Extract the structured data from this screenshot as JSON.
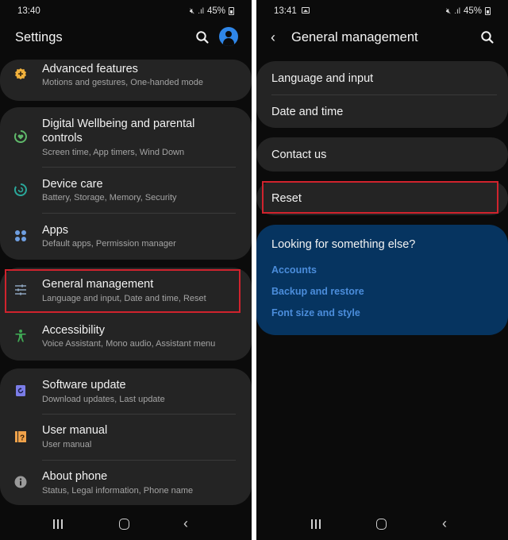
{
  "left_screen": {
    "status": {
      "time": "13:40",
      "battery": "45%"
    },
    "header": {
      "title": "Settings",
      "search_icon": "search-icon",
      "avatar_icon": "account-icon"
    },
    "items": [
      {
        "title": "Advanced features",
        "subtitle": "Motions and gestures, One-handed mode",
        "icon": "advanced-features-icon",
        "icon_color": "#f1b13c"
      },
      {
        "title": "Digital Wellbeing and parental controls",
        "subtitle": "Screen time, App timers, Wind Down",
        "icon": "digital-wellbeing-icon",
        "icon_color": "#5fb86a"
      },
      {
        "title": "Device care",
        "subtitle": "Battery, Storage, Memory, Security",
        "icon": "device-care-icon",
        "icon_color": "#2aa79a"
      },
      {
        "title": "Apps",
        "subtitle": "Default apps, Permission manager",
        "icon": "apps-icon",
        "icon_color": "#6e9ee0"
      },
      {
        "title": "General management",
        "subtitle": "Language and input, Date and time, Reset",
        "icon": "general-management-icon",
        "icon_color": "#8ca3bd",
        "highlighted": true
      },
      {
        "title": "Accessibility",
        "subtitle": "Voice Assistant, Mono audio, Assistant menu",
        "icon": "accessibility-icon",
        "icon_color": "#3fa653"
      },
      {
        "title": "Software update",
        "subtitle": "Download updates, Last update",
        "icon": "software-update-icon",
        "icon_color": "#7b7de8"
      },
      {
        "title": "User manual",
        "subtitle": "User manual",
        "icon": "user-manual-icon",
        "icon_color": "#f0a24a"
      },
      {
        "title": "About phone",
        "subtitle": "Status, Legal information, Phone name",
        "icon": "about-phone-icon",
        "icon_color": "#9a9a9a"
      }
    ]
  },
  "right_screen": {
    "status": {
      "time": "13:41",
      "battery": "45%"
    },
    "header": {
      "title": "General management",
      "back_icon": "back-icon",
      "search_icon": "search-icon"
    },
    "items": [
      {
        "title": "Language and input"
      },
      {
        "title": "Date and time"
      },
      {
        "title": "Contact us"
      },
      {
        "title": "Reset",
        "highlighted": true
      }
    ],
    "suggestions": {
      "title": "Looking for something else?",
      "links": [
        "Accounts",
        "Backup and restore",
        "Font size and style"
      ]
    }
  },
  "colors": {
    "background": "#0b0b0b",
    "card": "#242424",
    "highlight_border": "#d0232d",
    "suggestion_card": "#063460",
    "link": "#4b8ddb"
  }
}
